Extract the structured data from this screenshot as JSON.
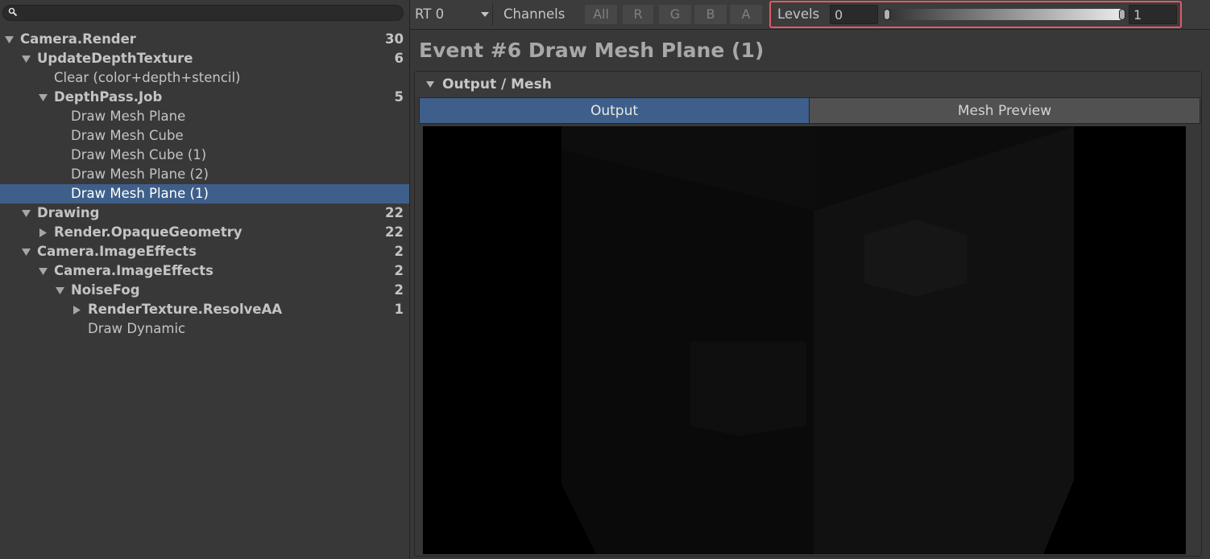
{
  "search": {
    "placeholder": ""
  },
  "tree": {
    "rows": [
      {
        "label": "Camera.Render",
        "count": "30",
        "depth": 0,
        "arrow": "down",
        "bold": true,
        "selected": false
      },
      {
        "label": "UpdateDepthTexture",
        "count": "6",
        "depth": 1,
        "arrow": "down",
        "bold": true,
        "selected": false
      },
      {
        "label": "Clear (color+depth+stencil)",
        "count": "",
        "depth": 2,
        "arrow": "none",
        "bold": false,
        "selected": false
      },
      {
        "label": "DepthPass.Job",
        "count": "5",
        "depth": 2,
        "arrow": "down",
        "bold": true,
        "selected": false
      },
      {
        "label": "Draw Mesh Plane",
        "count": "",
        "depth": 3,
        "arrow": "none",
        "bold": false,
        "selected": false
      },
      {
        "label": "Draw Mesh Cube",
        "count": "",
        "depth": 3,
        "arrow": "none",
        "bold": false,
        "selected": false
      },
      {
        "label": "Draw Mesh Cube (1)",
        "count": "",
        "depth": 3,
        "arrow": "none",
        "bold": false,
        "selected": false
      },
      {
        "label": "Draw Mesh Plane (2)",
        "count": "",
        "depth": 3,
        "arrow": "none",
        "bold": false,
        "selected": false
      },
      {
        "label": "Draw Mesh Plane (1)",
        "count": "",
        "depth": 3,
        "arrow": "none",
        "bold": false,
        "selected": true
      },
      {
        "label": "Drawing",
        "count": "22",
        "depth": 1,
        "arrow": "down",
        "bold": true,
        "selected": false
      },
      {
        "label": "Render.OpaqueGeometry",
        "count": "22",
        "depth": 2,
        "arrow": "right",
        "bold": true,
        "selected": false
      },
      {
        "label": "Camera.ImageEffects",
        "count": "2",
        "depth": 1,
        "arrow": "down",
        "bold": true,
        "selected": false
      },
      {
        "label": "Camera.ImageEffects",
        "count": "2",
        "depth": 2,
        "arrow": "down",
        "bold": true,
        "selected": false
      },
      {
        "label": "NoiseFog",
        "count": "2",
        "depth": 3,
        "arrow": "down",
        "bold": true,
        "selected": false
      },
      {
        "label": "RenderTexture.ResolveAA",
        "count": "1",
        "depth": 4,
        "arrow": "right",
        "bold": true,
        "selected": false
      },
      {
        "label": "Draw Dynamic",
        "count": "",
        "depth": 4,
        "arrow": "none",
        "bold": false,
        "selected": false
      }
    ]
  },
  "toolbar": {
    "render_target": "RT 0",
    "channels_label": "Channels",
    "channels": [
      "All",
      "R",
      "G",
      "B",
      "A"
    ],
    "levels_label": "Levels",
    "levels_min": "0",
    "levels_max": "1"
  },
  "event": {
    "title": "Event #6 Draw Mesh Plane (1)"
  },
  "section": {
    "title": "Output / Mesh",
    "tabs": [
      {
        "label": "Output",
        "active": true
      },
      {
        "label": "Mesh Preview",
        "active": false
      }
    ]
  },
  "colors": {
    "selection": "#3e5f8a",
    "highlight_border": "#e35a63",
    "panel_bg": "#383838"
  }
}
